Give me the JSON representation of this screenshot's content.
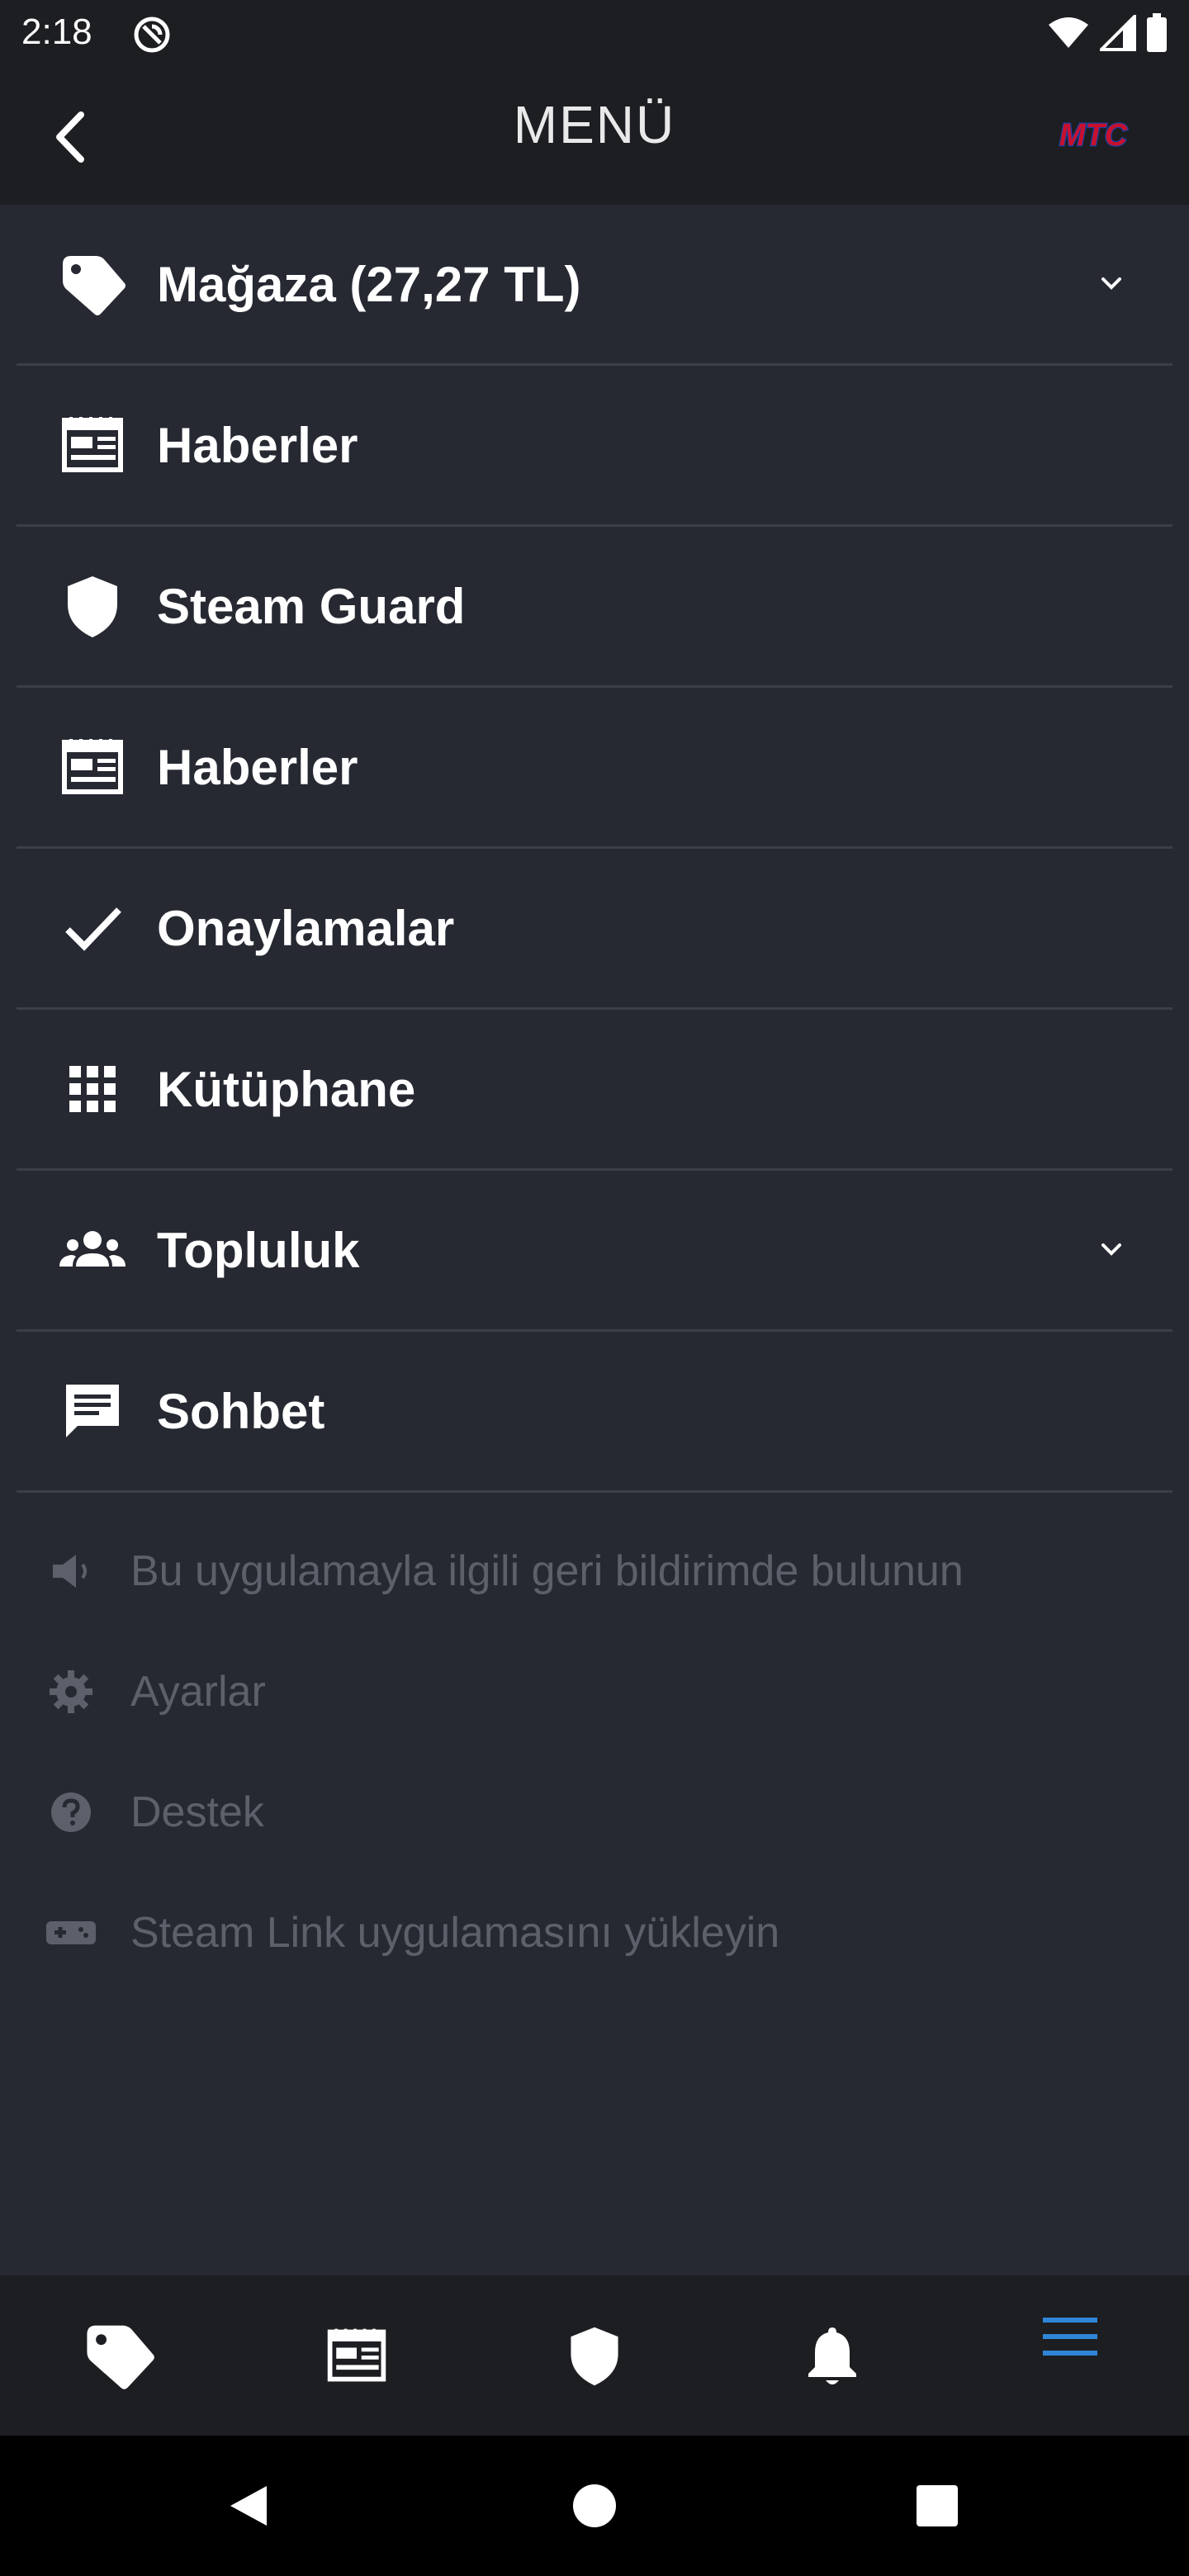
{
  "status_bar": {
    "time": "2:18"
  },
  "header": {
    "title": "MENÜ",
    "logo_text": "MTC"
  },
  "menu": {
    "items": [
      {
        "label": "Mağaza (27,27 TL)",
        "icon": "tag-icon",
        "has_chevron": true
      },
      {
        "label": "Haberler",
        "icon": "news-icon",
        "has_chevron": false
      },
      {
        "label": "Steam Guard",
        "icon": "shield-icon",
        "has_chevron": false
      },
      {
        "label": "Haberler",
        "icon": "news-icon",
        "has_chevron": false
      },
      {
        "label": "Onaylamalar",
        "icon": "check-icon",
        "has_chevron": false
      },
      {
        "label": "Kütüphane",
        "icon": "grid-icon",
        "has_chevron": false
      },
      {
        "label": "Topluluk",
        "icon": "people-icon",
        "has_chevron": true
      },
      {
        "label": "Sohbet",
        "icon": "chat-icon",
        "has_chevron": false
      }
    ]
  },
  "secondary": {
    "items": [
      {
        "label": "Bu uygulamayla ilgili geri bildirimde bulunun",
        "icon": "speaker-icon"
      },
      {
        "label": "Ayarlar",
        "icon": "gear-icon"
      },
      {
        "label": "Destek",
        "icon": "help-icon"
      },
      {
        "label": "Steam Link uygulamasını yükleyin",
        "icon": "gamepad-icon"
      }
    ]
  },
  "bottom_nav": {
    "tabs": [
      "tag-icon",
      "news-icon",
      "shield-icon",
      "bell-icon",
      "menu-icon"
    ],
    "active_index": 4
  },
  "colors": {
    "background": "#262932",
    "bar": "#1d1e22",
    "accent": "#2f86d8",
    "muted_text": "#5d606a",
    "divider": "#3b3f4a"
  }
}
